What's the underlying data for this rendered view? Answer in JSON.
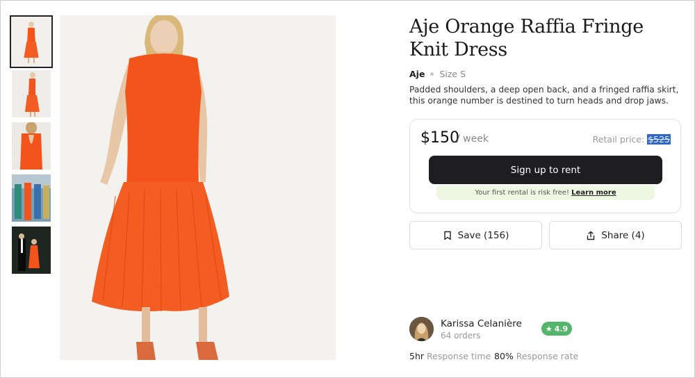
{
  "product": {
    "title": "Aje Orange Raffia Fringe Knit Dress",
    "brand": "Aje",
    "size": "Size S",
    "description": "Padded shoulders, a deep open back, and a fringed raffia skirt, this orange number is destined to turn heads and drop jaws."
  },
  "pricing": {
    "price": "$150",
    "period": "/ week",
    "retail_label": "Retail price:",
    "retail_value": "$525",
    "cta_label": "Sign up to rent",
    "risk_text": "Your first rental is risk free!",
    "risk_link": "Learn more"
  },
  "actions": {
    "save_label": "Save (156)",
    "share_label": "Share (4)"
  },
  "seller": {
    "name": "Karissa Celanière",
    "orders": "64 orders",
    "rating": "4.9",
    "response_time_value": "5hr",
    "response_time_label": "Response time",
    "response_rate_value": "80%",
    "response_rate_label": "Response rate"
  },
  "colors": {
    "dress": "#f2541b",
    "button": "#1e1e21",
    "rating_badge": "#54b66a",
    "risk_bg": "#edf7e2"
  },
  "icons": {
    "save": "bookmark-icon",
    "share": "share-icon",
    "rating": "star-icon"
  }
}
